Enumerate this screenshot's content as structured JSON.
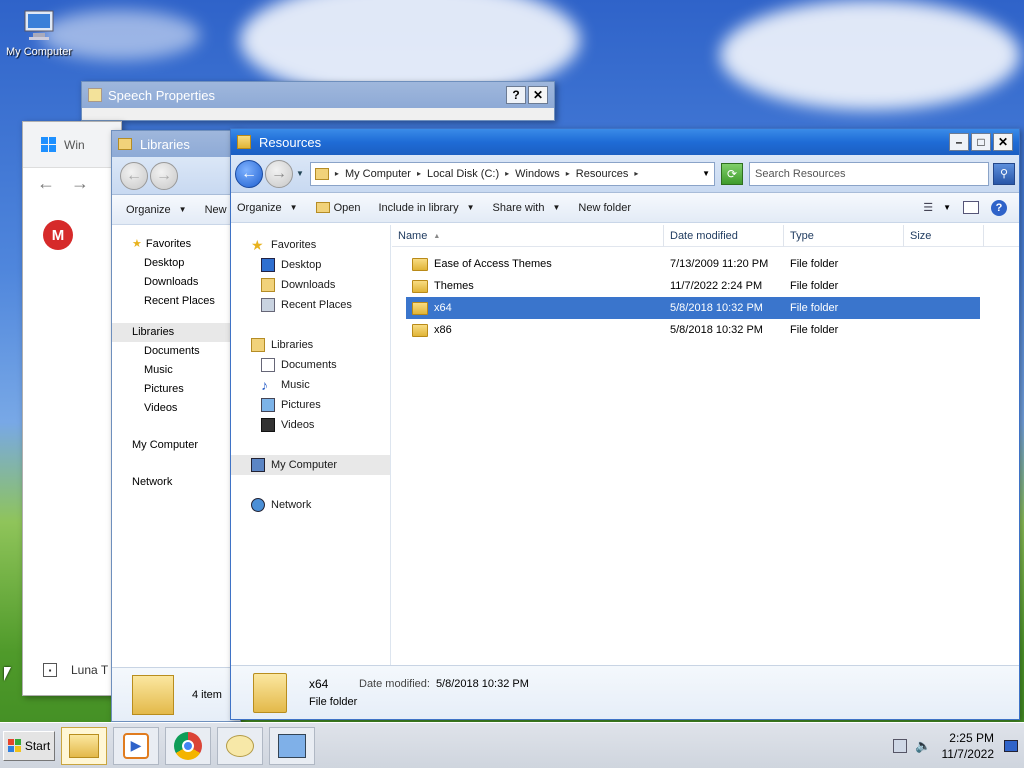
{
  "desktop": {
    "icons": [
      {
        "label": "My Computer"
      }
    ]
  },
  "speech_window": {
    "title": "Speech Properties",
    "help": "?",
    "close": "✕"
  },
  "chrome_window": {
    "tab_label": "Win",
    "logo_letter": "M",
    "bottom_label": "Luna T"
  },
  "libraries_window": {
    "title": "Libraries",
    "toolbar": {
      "organize": "Organize",
      "new": "New"
    },
    "nav": {
      "favorites": "Favorites",
      "desktop": "Desktop",
      "downloads": "Downloads",
      "recent": "Recent Places",
      "libraries": "Libraries",
      "documents": "Documents",
      "music": "Music",
      "pictures": "Pictures",
      "videos": "Videos",
      "computer": "My Computer",
      "network": "Network"
    },
    "status": "4 item"
  },
  "resources_window": {
    "title": "Resources",
    "breadcrumb": [
      "My Computer",
      "Local Disk (C:)",
      "Windows",
      "Resources"
    ],
    "search_placeholder": "Search Resources",
    "toolbar": {
      "organize": "Organize",
      "open": "Open",
      "include": "Include in library",
      "share": "Share with",
      "new_folder": "New folder"
    },
    "nav": {
      "favorites": "Favorites",
      "desktop": "Desktop",
      "downloads": "Downloads",
      "recent": "Recent Places",
      "libraries": "Libraries",
      "documents": "Documents",
      "music": "Music",
      "pictures": "Pictures",
      "videos": "Videos",
      "computer": "My Computer",
      "network": "Network"
    },
    "columns": {
      "name": "Name",
      "date": "Date modified",
      "type": "Type",
      "size": "Size"
    },
    "files": [
      {
        "name": "Ease of Access Themes",
        "date": "7/13/2009 11:20 PM",
        "type": "File folder",
        "size": ""
      },
      {
        "name": "Themes",
        "date": "11/7/2022 2:24 PM",
        "type": "File folder",
        "size": ""
      },
      {
        "name": "x64",
        "date": "5/8/2018 10:32 PM",
        "type": "File folder",
        "size": ""
      },
      {
        "name": "x86",
        "date": "5/8/2018 10:32 PM",
        "type": "File folder",
        "size": ""
      }
    ],
    "details": {
      "name": "x64",
      "date_label": "Date modified:",
      "date_value": "5/8/2018 10:32 PM",
      "type": "File folder"
    }
  },
  "taskbar": {
    "start": "Start",
    "time": "2:25 PM",
    "date": "11/7/2022"
  }
}
